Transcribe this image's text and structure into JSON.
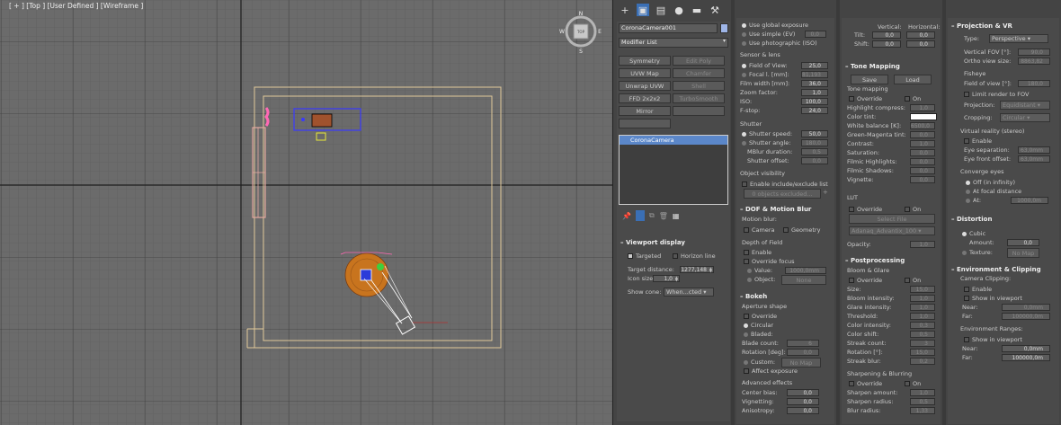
{
  "viewport": {
    "label": "[ + ] [Top ] [User Defined ] [Wireframe ]",
    "viewcube_labels": {
      "n": "N",
      "s": "S",
      "w": "W",
      "e": "E",
      "face": "TOP"
    }
  },
  "command_panel": {
    "tabs": [
      "create",
      "modify",
      "hierarchy",
      "motion",
      "display",
      "utilities"
    ],
    "object_name": "CoronaCamera001",
    "modifier_list": "Modifier List",
    "modifier_buttons": [
      "Symmetry",
      "Edit Poly",
      "UVW Map",
      "Chamfer",
      "Unwrap UVW",
      "Shell",
      "FFD 2x2x2",
      "TurboSmooth",
      "Mirror",
      "",
      ""
    ],
    "stack_item": "CoronaCamera",
    "viewport_display": {
      "title": "Viewport display",
      "targeted": "Targeted",
      "horizon_line": "Horizon line",
      "target_distance_label": "Target distance:",
      "target_distance": "1277,148",
      "icon_size_label": "Icon size:",
      "icon_size": "1,0",
      "show_cone_label": "Show cone:",
      "show_cone": "When...cted"
    }
  },
  "col2": {
    "exposure": [
      "Use global exposure",
      "Use simple (EV)",
      "Use photographic (ISO)"
    ],
    "simple_ev": "0,0",
    "sensor_title": "Sensor & lens",
    "fov_label": "Field of View:",
    "fov": "25,0",
    "focal_label": "Focal l. [mm]:",
    "focal": "81,193",
    "film_label": "Film width [mm]:",
    "film": "36,0",
    "zoom_label": "Zoom factor:",
    "zoom": "1,0",
    "iso_label": "ISO:",
    "iso": "100,0",
    "fstop_label": "F-stop:",
    "fstop": "24,0",
    "shutter_title": "Shutter",
    "shutter_speed_label": "Shutter speed:",
    "shutter_speed": "50,0",
    "shutter_angle_label": "Shutter angle:",
    "shutter_angle": "180,0",
    "mblur_label": "MBlur duration:",
    "mblur": "0,5",
    "shutter_offset_label": "Shutter offset:",
    "shutter_offset": "0,0",
    "visibility_title": "Object visibility",
    "visibility_enable": "Enable include/exclude list",
    "visibility_count": "0 objects excluded...",
    "dof_title": "DOF & Motion Blur",
    "motion_blur_label": "Motion blur:",
    "mb_camera": "Camera",
    "mb_geometry": "Geometry",
    "dof_label": "Depth of Field",
    "dof_enable": "Enable",
    "dof_override": "Override focus",
    "dof_value_label": "Value:",
    "dof_value": "1000,0mm",
    "dof_object_label": "Object:",
    "dof_object": "None",
    "bokeh_title": "Bokeh",
    "aperture_label": "Aperture shape",
    "ap_override": "Override",
    "ap_circular": "Circular",
    "ap_bladed": "Bladed:",
    "blade_count_label": "Blade count:",
    "blade_count": "6",
    "rotation_label": "Rotation [deg]:",
    "rotation": "0,0",
    "custom_label": "Custom:",
    "custom_btn": "No Map",
    "affect_exposure": "Affect exposure",
    "advanced_label": "Advanced effects",
    "center_bias_label": "Center bias:",
    "center_bias": "0,0",
    "vignetting_label": "Vignetting:",
    "vignetting": "0,0",
    "anisotropy_label": "Anisotropy:",
    "anisotropy": "0,0"
  },
  "col3": {
    "vertical_label": "Vertical:",
    "horizontal_label": "Horizontal:",
    "tilt_label": "Tilt:",
    "tilt_v": "0,0",
    "tilt_h": "0,0",
    "shift_label": "Shift:",
    "shift_v": "0,0",
    "shift_h": "0,0",
    "tone_title": "Tone Mapping",
    "save": "Save",
    "load": "Load",
    "tm_label": "Tone mapping",
    "override": "Override",
    "on": "On",
    "hl_label": "Highlight compress:",
    "hl": "1,0",
    "tint_label": "Color tint:",
    "wb_label": "White balance [K]:",
    "wb": "6500,0",
    "gm_label": "Green-Magenta tint:",
    "gm": "0,0",
    "contrast_label": "Contrast:",
    "contrast": "1,0",
    "saturation_label": "Saturation:",
    "saturation": "0,0",
    "fh_label": "Filmic Highlights:",
    "fh": "0,0",
    "fs_label": "Filmic Shadows:",
    "fs": "0,0",
    "vignette_label": "Vignette:",
    "vignette": "0,0",
    "lut_label": "LUT",
    "lut_override": "Override",
    "lut_on": "On",
    "select_file": "Select File",
    "lut_file": "Adanaq_Advantix_100",
    "opacity_label": "Opacity:",
    "opacity": "1,0",
    "post_title": "Postprocessing",
    "bloom_label": "Bloom & Glare",
    "bg_override": "Override",
    "bg_on": "On",
    "size_label": "Size:",
    "size": "15,0",
    "bloom_int_label": "Bloom intensity:",
    "bloom_int": "1,0",
    "glare_int_label": "Glare intensity:",
    "glare_int": "1,0",
    "threshold_label": "Threshold:",
    "threshold": "1,0",
    "color_int_label": "Color intensity:",
    "color_int": "0,3",
    "color_shift_label": "Color shift:",
    "color_shift": "0,5",
    "streak_count_label": "Streak count:",
    "streak_count": "3",
    "rotation_label": "Rotation [°]:",
    "rotation": "15,0",
    "streak_blur_label": "Streak blur:",
    "streak_blur": "0,2",
    "sharpen_label": "Sharpening & Blurring",
    "sh_override": "Override",
    "sh_on": "On",
    "sharpen_amount_label": "Sharpen amount:",
    "sharpen_amount": "1,0",
    "sharpen_radius_label": "Sharpen radius:",
    "sharpen_radius": "0,5",
    "blur_radius_label": "Blur radius:",
    "blur_radius": "1,33"
  },
  "col4": {
    "proj_title": "Projection & VR",
    "type_label": "Type:",
    "type": "Perspective",
    "vfov_label": "Vertical FOV [°]:",
    "vfov": "90,0",
    "ortho_label": "Ortho view size:",
    "ortho": "8863,82",
    "fisheye_label": "Fisheye",
    "fish_fov_label": "Field of view [°]:",
    "fish_fov": "180,0",
    "limit_render": "Limit render to FOV",
    "projection_label": "Projection:",
    "projection": "Equidistant",
    "cropping_label": "Cropping:",
    "cropping": "Circular",
    "vr_label": "Virtual reality (stereo)",
    "vr_enable": "Enable",
    "eye_sep_label": "Eye separation:",
    "eye_sep": "63,0mm",
    "eye_front_label": "Eye front offset:",
    "eye_front": "63,0mm",
    "converge_label": "Converge eyes",
    "conv_off": "Off (in infinity)",
    "conv_focal": "At focal distance",
    "conv_at_label": "At:",
    "conv_at": "1000,0m",
    "distortion_title": "Distortion",
    "cubic": "Cubic",
    "amount_label": "Amount:",
    "amount": "0,0",
    "texture_label": "Texture:",
    "texture": "No Map",
    "env_title": "Environment & Clipping",
    "clip_label": "Camera Clipping:",
    "clip_enable": "Enable",
    "clip_show": "Show in viewport",
    "near_label": "Near:",
    "clip_near": "0,0mm",
    "far_label": "Far:",
    "clip_far": "100000,0m",
    "env_ranges_label": "Environment Ranges:",
    "env_show": "Show in viewport",
    "env_near": "0,0mm",
    "env_far": "100000,0m"
  }
}
